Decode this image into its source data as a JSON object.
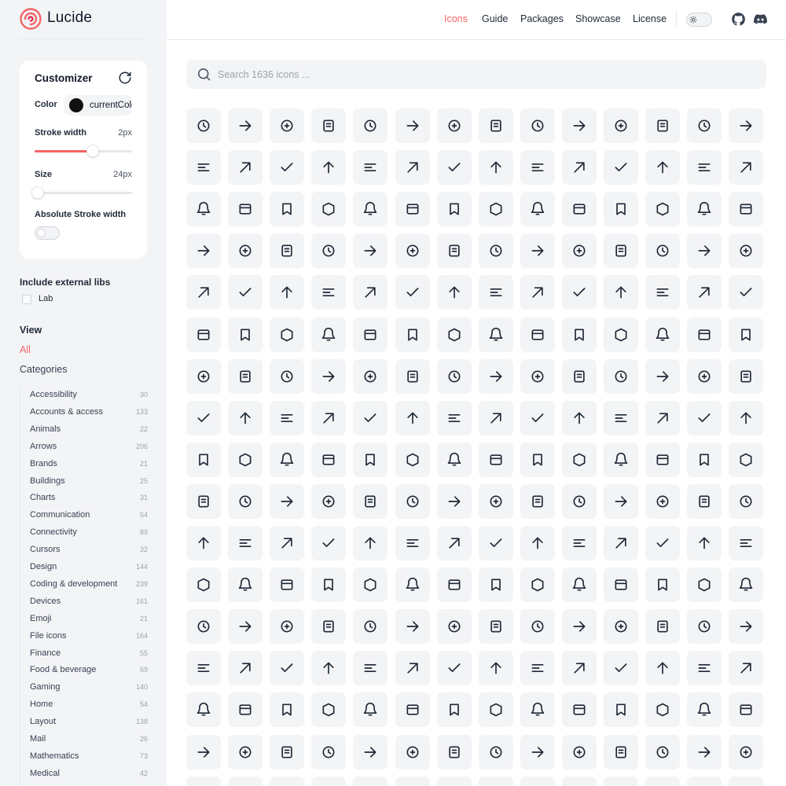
{
  "app": {
    "name": "Lucide"
  },
  "header": {
    "nav": [
      {
        "label": "Icons",
        "active": true,
        "icon": "none"
      },
      {
        "label": "Guide"
      },
      {
        "label": "Packages"
      },
      {
        "label": "Showcase"
      },
      {
        "label": "License"
      }
    ],
    "icons": [
      "sun-icon",
      "github-icon",
      "discord-icon"
    ]
  },
  "colors": {
    "accent": "#f56565",
    "tile": "#f3f4f6",
    "sidebar": "#f3f4f6"
  },
  "customizer": {
    "title": "Customizer",
    "color_label": "Color",
    "color_value": "currentColor",
    "stroke_label": "Stroke width",
    "stroke_value": "2px",
    "stroke_fraction": 0.6,
    "size_label": "Size",
    "size_value": "24px",
    "size_fraction": 0.0,
    "absolute_label": "Absolute Stroke width",
    "absolute_on": false
  },
  "external_libs": {
    "title": "Include external libs",
    "items": [
      {
        "label": "Lab",
        "checked": false
      }
    ]
  },
  "view": {
    "title": "View",
    "all_label": "All",
    "categories_title": "Categories"
  },
  "categories": [
    {
      "name": "Accessibility",
      "count": "30"
    },
    {
      "name": "Accounts & access",
      "count": "133"
    },
    {
      "name": "Animals",
      "count": "22"
    },
    {
      "name": "Arrows",
      "count": "206"
    },
    {
      "name": "Brands",
      "count": "21"
    },
    {
      "name": "Buildings",
      "count": "25"
    },
    {
      "name": "Charts",
      "count": "31"
    },
    {
      "name": "Communication",
      "count": "54"
    },
    {
      "name": "Connectivity",
      "count": "89"
    },
    {
      "name": "Cursors",
      "count": "32"
    },
    {
      "name": "Design",
      "count": "144"
    },
    {
      "name": "Coding & development",
      "count": "239"
    },
    {
      "name": "Devices",
      "count": "161"
    },
    {
      "name": "Emoji",
      "count": "21"
    },
    {
      "name": "File icons",
      "count": "164"
    },
    {
      "name": "Finance",
      "count": "55"
    },
    {
      "name": "Food & beverage",
      "count": "69"
    },
    {
      "name": "Gaming",
      "count": "140"
    },
    {
      "name": "Home",
      "count": "54"
    },
    {
      "name": "Layout",
      "count": "138"
    },
    {
      "name": "Mail",
      "count": "26"
    },
    {
      "name": "Mathematics",
      "count": "73"
    },
    {
      "name": "Medical",
      "count": "42"
    }
  ],
  "search": {
    "placeholder": "Search 1636 icons ..."
  },
  "icon_rows": [
    [
      "a-arrow-down-icon",
      "a-arrow-up-icon",
      "a-large-small-icon",
      "accessibility-icon",
      "activity-icon",
      "air-vent-icon",
      "airplay-icon",
      "alarm-clock-icon",
      "alarm-clock-check-icon",
      "alarm-clock-minus-icon",
      "alarm-clock-off-icon",
      "alarm-clock-plus-icon",
      "alarm-smoke-icon",
      "album-icon"
    ],
    [
      "align-center-horizontal-icon",
      "align-center-vertical-icon",
      "align-end-horizontal-icon",
      "align-end-vertical-icon",
      "align-horizontal-distribute-center-icon",
      "align-horizontal-distribute-end-icon",
      "align-horizontal-distribute-start-icon",
      "align-horizontal-justify-center-icon",
      "align-horizontal-justify-end-icon",
      "align-horizontal-justify-start-icon",
      "align-horizontal-space-around-icon",
      "align-horizontal-space-between-icon",
      "align-start-horizontal-icon",
      "align-start-vertical-icon"
    ],
    [
      "align-vertical-distribute-center-icon",
      "align-vertical-distribute-end-icon",
      "align-vertical-distribute-start-icon",
      "align-vertical-justify-center-icon",
      "align-vertical-justify-end-icon",
      "align-vertical-justify-start-icon",
      "align-vertical-space-around-icon",
      "align-vertical-space-between-icon",
      "ambulance-icon",
      "ampersand-icon",
      "ampersands-icon",
      "amphora-icon",
      "anchor-icon",
      "angry-icon"
    ],
    [
      "annoyed-icon",
      "antenna-icon",
      "anvil-icon",
      "aperture-icon",
      "app-window-icon",
      "app-window-mac-icon",
      "apple-icon",
      "archive-icon",
      "archive-restore-icon",
      "archive-x-icon",
      "armchair-icon",
      "arrow-big-down-icon",
      "arrow-big-down-dash-icon",
      "arrow-big-left-icon"
    ],
    [
      "arrow-big-left-dash-icon",
      "arrow-big-right-icon",
      "arrow-big-right-dash-icon",
      "arrow-big-up-icon",
      "arrow-big-up-dash-icon",
      "arrow-down-icon",
      "arrow-down-0-1-icon",
      "arrow-down-1-0-icon",
      "arrow-down-a-z-icon",
      "arrow-down-from-line-icon",
      "arrow-down-left-icon",
      "arrow-down-narrow-wide-icon",
      "arrow-down-right-icon",
      "arrow-down-to-dot-icon"
    ],
    [
      "arrow-down-to-line-icon",
      "arrow-down-up-icon",
      "arrow-down-wide-narrow-icon",
      "arrow-down-z-a-icon",
      "arrow-left-icon",
      "arrow-left-from-line-icon",
      "arrow-left-right-icon",
      "arrow-left-to-line-icon",
      "arrow-right-icon",
      "arrow-right-from-line-icon",
      "arrow-right-left-icon",
      "arrow-right-to-line-icon",
      "arrow-up-icon",
      "arrow-up-0-1-icon"
    ],
    [
      "arrow-up-1-0-icon",
      "arrow-up-a-z-icon",
      "arrow-up-down-icon",
      "arrow-up-from-dot-icon",
      "arrow-up-from-line-icon",
      "arrow-up-left-icon",
      "arrow-up-narrow-wide-icon",
      "arrow-up-right-icon",
      "arrow-up-to-line-icon",
      "arrow-up-wide-narrow-icon",
      "arrow-up-z-a-icon",
      "arrows-up-from-line-icon",
      "asterisk-icon",
      "at-sign-icon"
    ],
    [
      "atom-icon",
      "audio-lines-icon",
      "audio-waveform-icon",
      "award-icon",
      "axe-icon",
      "axis-3d-icon",
      "baby-icon",
      "backpack-icon",
      "badge-icon",
      "badge-alert-icon",
      "badge-cent-icon",
      "badge-check-icon",
      "badge-dollar-sign-icon",
      "badge-euro-icon"
    ],
    [
      "badge-indian-rupee-icon",
      "badge-info-icon",
      "badge-japanese-yen-icon",
      "badge-minus-icon",
      "badge-percent-icon",
      "badge-plus-icon",
      "badge-pound-sterling-icon",
      "badge-help-icon",
      "badge-russian-ruble-icon",
      "badge-swiss-franc-icon",
      "badge-turkish-lira-icon",
      "badge-x-icon",
      "baggage-claim-icon",
      "ban-icon"
    ],
    [
      "banana-icon",
      "bandage-icon",
      "banknote-icon",
      "banknote-arrow-down-icon",
      "banknote-arrow-up-icon",
      "banknote-x-icon",
      "barcode-icon",
      "barrel-icon",
      "baseline-icon",
      "bath-icon",
      "battery-icon",
      "battery-charging-icon",
      "battery-full-icon",
      "battery-low-icon"
    ],
    [
      "battery-medium-icon",
      "battery-plus-icon",
      "battery-warning-icon",
      "beaker-icon",
      "bean-icon",
      "bean-off-icon",
      "bed-icon",
      "bed-double-icon",
      "bed-single-icon",
      "beef-icon",
      "beer-icon",
      "beer-off-icon",
      "bell-icon",
      "bell-dot-icon"
    ],
    [
      "bell-electric-icon",
      "bell-minus-icon",
      "bell-off-icon",
      "bell-plus-icon",
      "bell-ring-icon",
      "between-horizontal-end-icon",
      "between-horizontal-start-icon",
      "between-vertical-end-icon",
      "between-vertical-start-icon",
      "biceps-flexed-icon",
      "bike-icon",
      "binary-icon",
      "binoculars-icon",
      "biohazard-icon"
    ],
    [
      "bird-icon",
      "bitcoin-icon",
      "blend-icon",
      "blinds-icon",
      "blocks-icon",
      "bluetooth-icon",
      "bluetooth-connected-icon",
      "bluetooth-off-icon",
      "bluetooth-searching-icon",
      "bold-icon",
      "bolt-icon",
      "bomb-icon",
      "bone-icon",
      "book-icon"
    ],
    [
      "book-a-icon",
      "book-alert-icon",
      "book-audio-icon",
      "book-check-icon",
      "book-copy-icon",
      "book-dashed-icon",
      "book-down-icon",
      "book-headphones-icon",
      "book-heart-icon",
      "book-image-icon",
      "book-key-icon",
      "book-lock-icon",
      "book-marked-icon",
      "book-minus-icon"
    ],
    [
      "book-open-icon",
      "book-open-check-icon",
      "book-open-text-icon",
      "book-plus-icon",
      "book-text-icon",
      "book-type-icon",
      "book-up-icon",
      "book-up-2-icon",
      "book-user-icon",
      "book-x-icon",
      "bookmark-icon",
      "bookmark-check-icon",
      "bookmark-minus-icon",
      "bookmark-plus-icon"
    ],
    [
      "bookmark-x-icon",
      "boom-box-icon",
      "bot-icon",
      "bot-message-square-icon",
      "bot-off-icon",
      "bottle-wine-icon",
      "bow-arrow-icon",
      "box-icon",
      "boxes-icon",
      "braces-icon",
      "brackets-icon",
      "brain-icon",
      "brain-circuit-icon",
      "brain-cog-icon"
    ],
    [
      "row17-icon",
      "row17-icon",
      "row17-icon",
      "row17-icon",
      "row17-icon",
      "row17-icon",
      "row17-icon",
      "row17-icon",
      "row17-icon",
      "row17-icon",
      "row17-icon",
      "row17-icon",
      "row17-icon",
      "row17-icon"
    ]
  ]
}
